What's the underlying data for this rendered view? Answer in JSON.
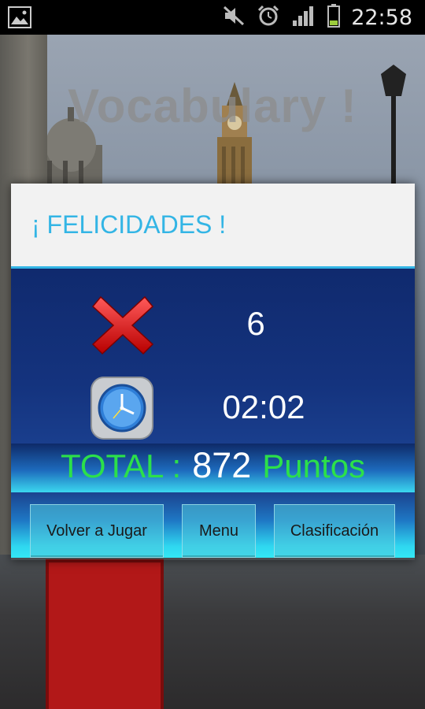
{
  "status_bar": {
    "time": "22:58"
  },
  "app": {
    "title": "Vocabulary !"
  },
  "dialog": {
    "title": "¡ FELICIDADES !",
    "errors": {
      "icon": "red-x-icon",
      "value": "6"
    },
    "time": {
      "icon": "clock-icon",
      "value": "02:02"
    },
    "total": {
      "label": "TOTAL :",
      "points": "872",
      "unit": "Puntos"
    },
    "buttons": {
      "play_again": "Volver a Jugar",
      "menu": "Menu",
      "ranking": "Clasificación"
    }
  },
  "colors": {
    "accent": "#33b5e5",
    "total_green": "#2ce04a",
    "button_bg": "#50c8dc"
  }
}
